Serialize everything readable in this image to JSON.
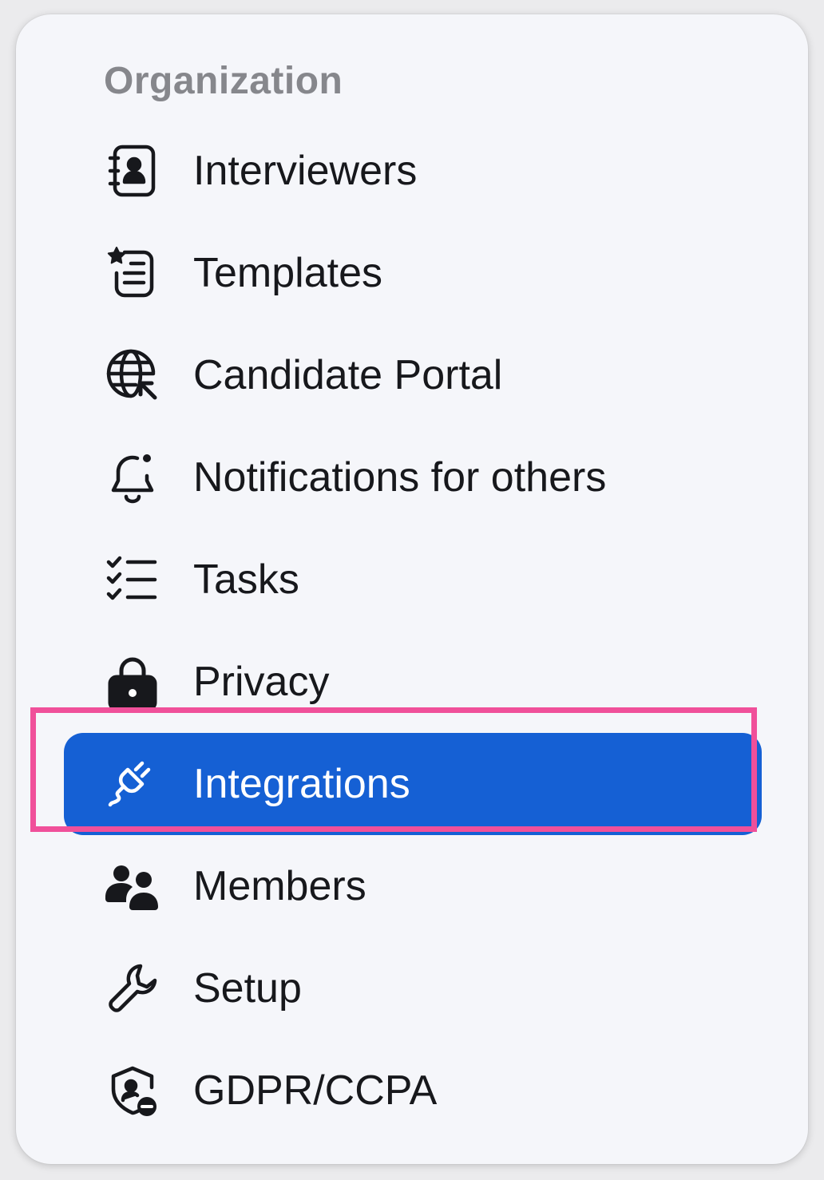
{
  "section": {
    "title": "Organization"
  },
  "items": [
    {
      "label": "Interviewers",
      "icon": "contact-book-icon"
    },
    {
      "label": "Templates",
      "icon": "starred-list-icon"
    },
    {
      "label": "Candidate Portal",
      "icon": "globe-cursor-icon"
    },
    {
      "label": "Notifications for others",
      "icon": "bell-dot-icon"
    },
    {
      "label": "Tasks",
      "icon": "checklist-icon"
    },
    {
      "label": "Privacy",
      "icon": "lock-icon"
    },
    {
      "label": "Integrations",
      "icon": "plug-icon",
      "active": true
    },
    {
      "label": "Members",
      "icon": "users-icon"
    },
    {
      "label": "Setup",
      "icon": "wrench-icon"
    },
    {
      "label": "GDPR/CCPA",
      "icon": "shield-user-minus-icon"
    }
  ],
  "colors": {
    "active_background": "#1560d4",
    "highlight_border": "#f0509a",
    "panel_background": "#f5f6fa",
    "section_title": "#86878c",
    "item_text": "#17181c"
  }
}
